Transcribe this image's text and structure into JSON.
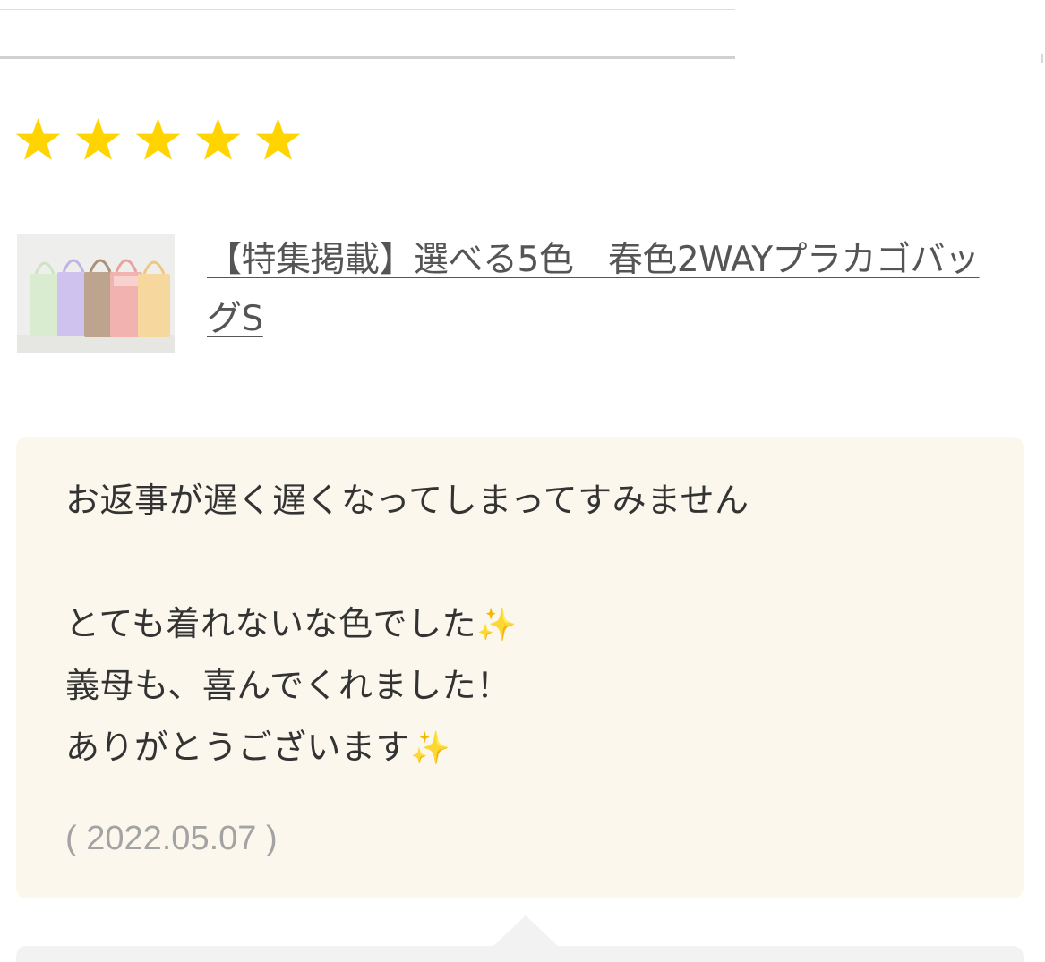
{
  "rating": {
    "stars": 5,
    "max": 5,
    "star_color": "#ffd400"
  },
  "product": {
    "thumbnail_icon": "bag-thumbnail-image",
    "title": "【特集掲載】選べる5色　春色2WAYプラカゴバッグS",
    "bag_colors": [
      "#d9ecd0",
      "#cfc2ee",
      "#bca48e",
      "#f2b3b0",
      "#f6d79d"
    ]
  },
  "review": {
    "lines": [
      "お返事が遅く遅くなってしまってすみません",
      "",
      "とても着れないな色でした",
      "義母も、喜んでくれました！",
      "ありがとうございます"
    ],
    "sparkle": "✨",
    "date": "( 2022.05.07 )",
    "background": "#fbf7ec"
  }
}
